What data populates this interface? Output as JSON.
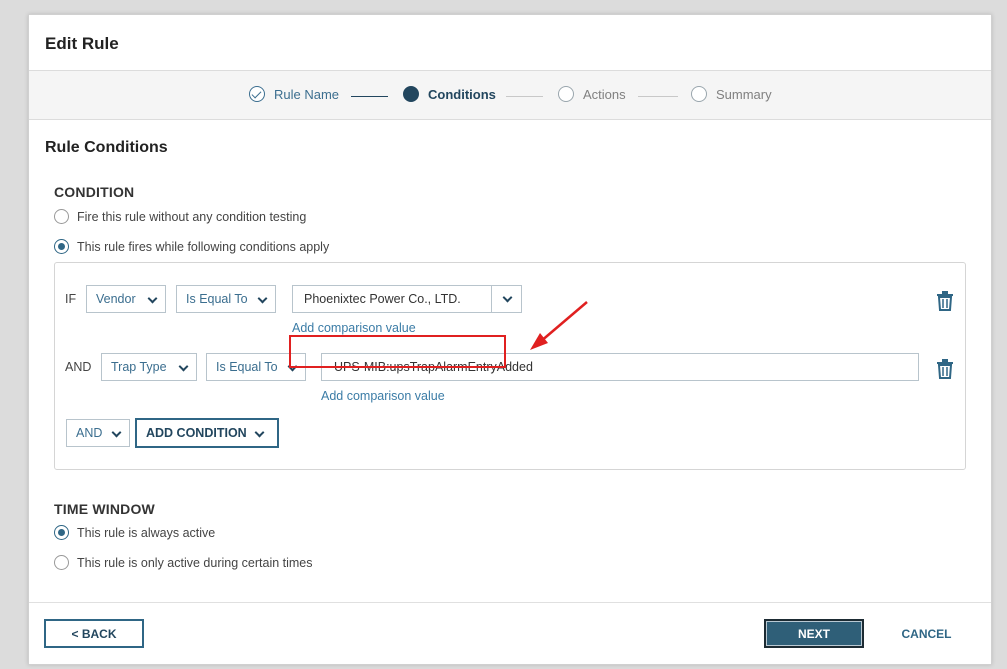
{
  "dialog": {
    "title": "Edit Rule"
  },
  "stepper": {
    "steps": [
      {
        "label": "Rule Name",
        "state": "done"
      },
      {
        "label": "Conditions",
        "state": "active"
      },
      {
        "label": "Actions",
        "state": "todo"
      },
      {
        "label": "Summary",
        "state": "todo"
      }
    ]
  },
  "section_title": "Rule Conditions",
  "condition": {
    "heading": "CONDITION",
    "options": [
      {
        "label": "Fire this rule without any condition testing",
        "selected": false
      },
      {
        "label": "This rule fires while following conditions apply",
        "selected": true
      }
    ],
    "rows": [
      {
        "keyword": "IF",
        "field": "Vendor",
        "operator": "Is Equal To",
        "value": "Phoenixtec Power Co., LTD.",
        "add_link": "Add comparison value"
      },
      {
        "keyword": "AND",
        "field": "Trap Type",
        "operator": "Is Equal To",
        "value": "UPS-MIB:upsTrapAlarmEntryAdded",
        "add_link": "Add comparison value"
      }
    ],
    "logic_select": "AND",
    "add_condition_label": "ADD CONDITION"
  },
  "time_window": {
    "heading": "TIME WINDOW",
    "options": [
      {
        "label": "This rule is always active",
        "selected": true
      },
      {
        "label": "This rule is only active during certain times",
        "selected": false
      }
    ]
  },
  "footer": {
    "back_label": "< BACK",
    "next_label": "NEXT",
    "cancel_label": "CANCEL"
  },
  "colors": {
    "accent": "#2f6685",
    "dark": "#22465e",
    "highlight": "#e02020"
  }
}
